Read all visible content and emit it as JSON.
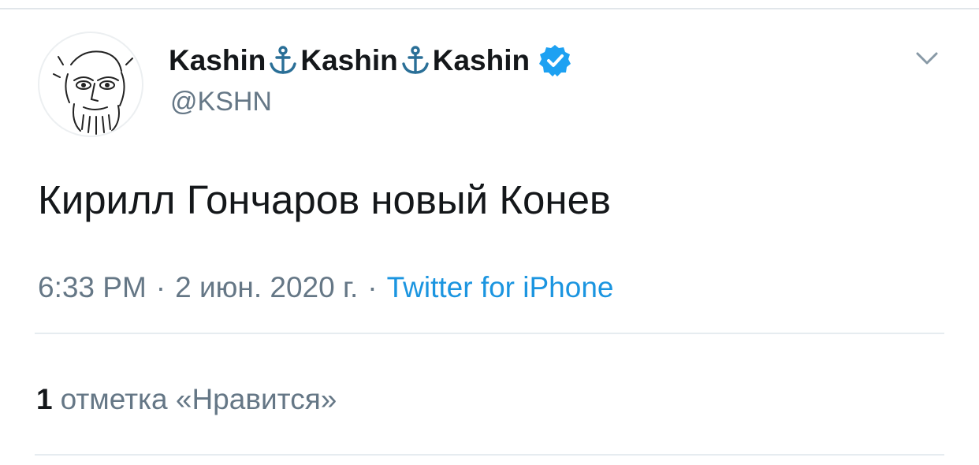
{
  "author": {
    "name_parts": [
      "Kashin",
      "Kashin",
      "Kashin"
    ],
    "separator_icon": "anchor-icon",
    "verified": true,
    "handle": "@KSHN",
    "avatar_icon": "sketch-portrait-avatar"
  },
  "tweet": {
    "text": "Кирилл Гончаров новый Конев"
  },
  "meta": {
    "time": "6:33 PM",
    "separator": "·",
    "date": "2 июн. 2020 г.",
    "source": "Twitter for iPhone"
  },
  "stats": {
    "likes_count": "1",
    "likes_label": "отметка «Нравится»"
  },
  "icons": {
    "more": "chevron-down-icon",
    "verified": "verified-badge-icon"
  },
  "colors": {
    "text": "#14171a",
    "secondary": "#657786",
    "link": "#1b95e0",
    "verified": "#1da1f2",
    "divider": "#e6ecf0"
  }
}
